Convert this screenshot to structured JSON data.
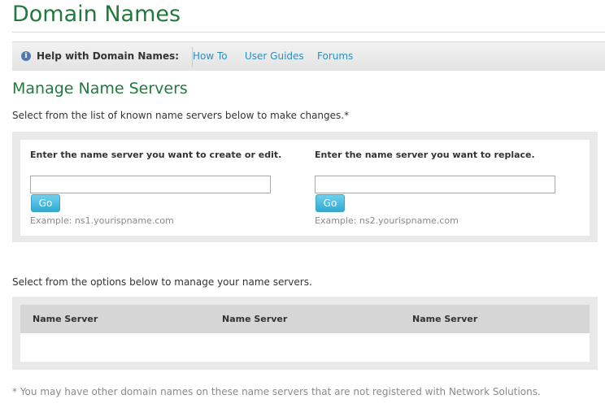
{
  "page": {
    "title": "Domain Names"
  },
  "help_bar": {
    "icon": "info-icon",
    "icon_glyph": "i",
    "label": "Help with Domain Names:",
    "links": [
      "How To",
      "User Guides",
      "Forums"
    ]
  },
  "manage": {
    "title": "Manage Name Servers",
    "intro": "Select from the list of known name servers below to make changes.*",
    "create_field": {
      "label": "Enter the name server you want to create or edit.",
      "value": "",
      "button": "Go",
      "example": "Example: ns1.yourispname.com"
    },
    "replace_field": {
      "label": "Enter the name server you want to replace.",
      "value": "",
      "button": "Go",
      "example": "Example: ns2.yourispname.com"
    }
  },
  "options": {
    "intro": "Select from the options below to manage your name servers.",
    "table": {
      "columns": [
        "Name Server",
        "Name Server",
        "Name Server"
      ],
      "rows": []
    }
  },
  "footnote": "* You may have other domain names on these name servers that are not registered with Network Solutions.",
  "colors": {
    "heading_green": "#1f7a3c",
    "link_blue": "#2a8fbd",
    "button_blue": "#32aad3"
  }
}
